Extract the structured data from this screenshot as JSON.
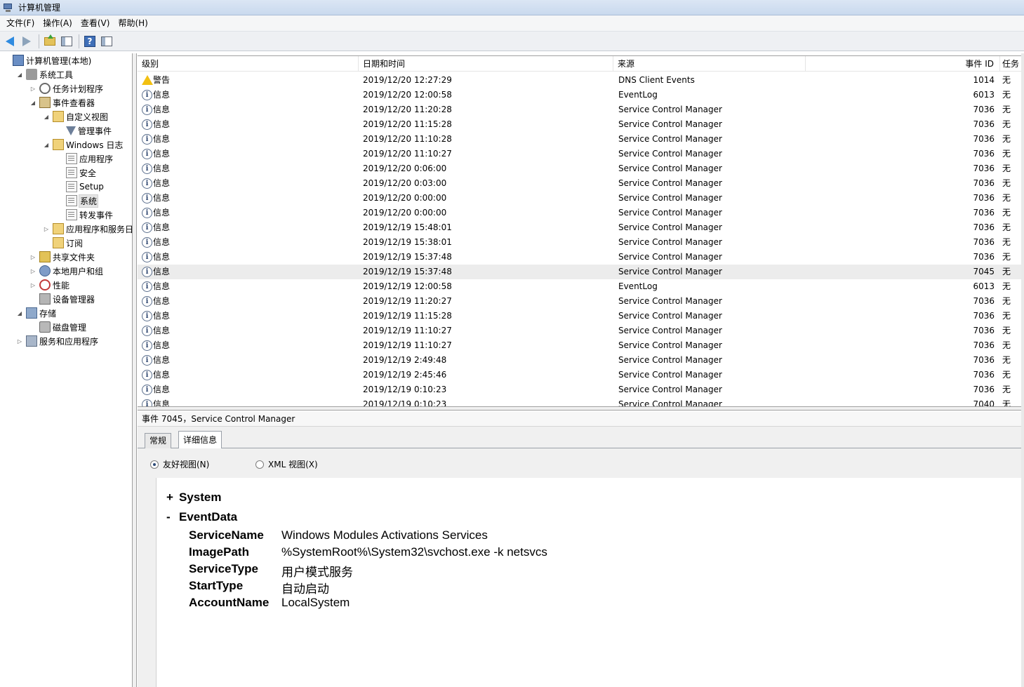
{
  "window": {
    "title": "计算机管理"
  },
  "menu": [
    "文件(F)",
    "操作(A)",
    "查看(V)",
    "帮助(H)"
  ],
  "tree": [
    {
      "label": "计算机管理(本地)",
      "indent": 0,
      "exp": "",
      "icon": "comp"
    },
    {
      "label": "系统工具",
      "indent": 1,
      "exp": "◢",
      "icon": "tools"
    },
    {
      "label": "任务计划程序",
      "indent": 2,
      "exp": "▷",
      "icon": "clock"
    },
    {
      "label": "事件查看器",
      "indent": 2,
      "exp": "◢",
      "icon": "evt"
    },
    {
      "label": "自定义视图",
      "indent": 3,
      "exp": "◢",
      "icon": "folder"
    },
    {
      "label": "管理事件",
      "indent": 4,
      "exp": "",
      "icon": "filter"
    },
    {
      "label": "Windows 日志",
      "indent": 3,
      "exp": "◢",
      "icon": "folder"
    },
    {
      "label": "应用程序",
      "indent": 4,
      "exp": "",
      "icon": "log"
    },
    {
      "label": "安全",
      "indent": 4,
      "exp": "",
      "icon": "log"
    },
    {
      "label": "Setup",
      "indent": 4,
      "exp": "",
      "icon": "log"
    },
    {
      "label": "系统",
      "indent": 4,
      "exp": "",
      "icon": "log",
      "selected": true
    },
    {
      "label": "转发事件",
      "indent": 4,
      "exp": "",
      "icon": "log"
    },
    {
      "label": "应用程序和服务日志",
      "indent": 3,
      "exp": "▷",
      "icon": "folder"
    },
    {
      "label": "订阅",
      "indent": 3,
      "exp": "",
      "icon": "folder"
    },
    {
      "label": "共享文件夹",
      "indent": 2,
      "exp": "▷",
      "icon": "share"
    },
    {
      "label": "本地用户和组",
      "indent": 2,
      "exp": "▷",
      "icon": "users"
    },
    {
      "label": "性能",
      "indent": 2,
      "exp": "▷",
      "icon": "perf"
    },
    {
      "label": "设备管理器",
      "indent": 2,
      "exp": "",
      "icon": "device"
    },
    {
      "label": "存储",
      "indent": 1,
      "exp": "◢",
      "icon": "storage"
    },
    {
      "label": "磁盘管理",
      "indent": 2,
      "exp": "",
      "icon": "disk"
    },
    {
      "label": "服务和应用程序",
      "indent": 1,
      "exp": "▷",
      "icon": "svc"
    }
  ],
  "columns": {
    "level": "级别",
    "datetime": "日期和时间",
    "source": "来源",
    "eventid": "事件 ID",
    "task": "任务"
  },
  "events": [
    {
      "level": "警告",
      "type": "warn",
      "datetime": "2019/12/20 12:27:29",
      "source": "DNS Client Events",
      "id": "1014",
      "task": "无"
    },
    {
      "level": "信息",
      "type": "info",
      "datetime": "2019/12/20 12:00:58",
      "source": "EventLog",
      "id": "6013",
      "task": "无"
    },
    {
      "level": "信息",
      "type": "info",
      "datetime": "2019/12/20 11:20:28",
      "source": "Service Control Manager",
      "id": "7036",
      "task": "无"
    },
    {
      "level": "信息",
      "type": "info",
      "datetime": "2019/12/20 11:15:28",
      "source": "Service Control Manager",
      "id": "7036",
      "task": "无"
    },
    {
      "level": "信息",
      "type": "info",
      "datetime": "2019/12/20 11:10:28",
      "source": "Service Control Manager",
      "id": "7036",
      "task": "无"
    },
    {
      "level": "信息",
      "type": "info",
      "datetime": "2019/12/20 11:10:27",
      "source": "Service Control Manager",
      "id": "7036",
      "task": "无"
    },
    {
      "level": "信息",
      "type": "info",
      "datetime": "2019/12/20 0:06:00",
      "source": "Service Control Manager",
      "id": "7036",
      "task": "无"
    },
    {
      "level": "信息",
      "type": "info",
      "datetime": "2019/12/20 0:03:00",
      "source": "Service Control Manager",
      "id": "7036",
      "task": "无"
    },
    {
      "level": "信息",
      "type": "info",
      "datetime": "2019/12/20 0:00:00",
      "source": "Service Control Manager",
      "id": "7036",
      "task": "无"
    },
    {
      "level": "信息",
      "type": "info",
      "datetime": "2019/12/20 0:00:00",
      "source": "Service Control Manager",
      "id": "7036",
      "task": "无"
    },
    {
      "level": "信息",
      "type": "info",
      "datetime": "2019/12/19 15:48:01",
      "source": "Service Control Manager",
      "id": "7036",
      "task": "无"
    },
    {
      "level": "信息",
      "type": "info",
      "datetime": "2019/12/19 15:38:01",
      "source": "Service Control Manager",
      "id": "7036",
      "task": "无"
    },
    {
      "level": "信息",
      "type": "info",
      "datetime": "2019/12/19 15:37:48",
      "source": "Service Control Manager",
      "id": "7036",
      "task": "无"
    },
    {
      "level": "信息",
      "type": "info",
      "datetime": "2019/12/19 15:37:48",
      "source": "Service Control Manager",
      "id": "7045",
      "task": "无",
      "selected": true
    },
    {
      "level": "信息",
      "type": "info",
      "datetime": "2019/12/19 12:00:58",
      "source": "EventLog",
      "id": "6013",
      "task": "无"
    },
    {
      "level": "信息",
      "type": "info",
      "datetime": "2019/12/19 11:20:27",
      "source": "Service Control Manager",
      "id": "7036",
      "task": "无"
    },
    {
      "level": "信息",
      "type": "info",
      "datetime": "2019/12/19 11:15:28",
      "source": "Service Control Manager",
      "id": "7036",
      "task": "无"
    },
    {
      "level": "信息",
      "type": "info",
      "datetime": "2019/12/19 11:10:27",
      "source": "Service Control Manager",
      "id": "7036",
      "task": "无"
    },
    {
      "level": "信息",
      "type": "info",
      "datetime": "2019/12/19 11:10:27",
      "source": "Service Control Manager",
      "id": "7036",
      "task": "无"
    },
    {
      "level": "信息",
      "type": "info",
      "datetime": "2019/12/19 2:49:48",
      "source": "Service Control Manager",
      "id": "7036",
      "task": "无"
    },
    {
      "level": "信息",
      "type": "info",
      "datetime": "2019/12/19 2:45:46",
      "source": "Service Control Manager",
      "id": "7036",
      "task": "无"
    },
    {
      "level": "信息",
      "type": "info",
      "datetime": "2019/12/19 0:10:23",
      "source": "Service Control Manager",
      "id": "7036",
      "task": "无"
    },
    {
      "level": "信息",
      "type": "info",
      "datetime": "2019/12/19 0:10:23",
      "source": "Service Control Manager",
      "id": "7040",
      "task": "无"
    }
  ],
  "detail": {
    "title": "事件 7045，Service Control Manager",
    "tabs": [
      "常规",
      "详细信息"
    ],
    "views": {
      "friendly": "友好视图(N)",
      "xml": "XML 视图(X)"
    },
    "system_label": "System",
    "system_sym": "+",
    "eventdata_label": "EventData",
    "eventdata_sym": "-",
    "fields": [
      {
        "key": "ServiceName",
        "value": "Windows Modules Activations Services"
      },
      {
        "key": "ImagePath",
        "value": "%SystemRoot%\\System32\\svchost.exe -k netsvcs"
      },
      {
        "key": "ServiceType",
        "value": "用户模式服务"
      },
      {
        "key": "StartType",
        "value": "自动启动"
      },
      {
        "key": "AccountName",
        "value": "LocalSystem"
      }
    ]
  }
}
